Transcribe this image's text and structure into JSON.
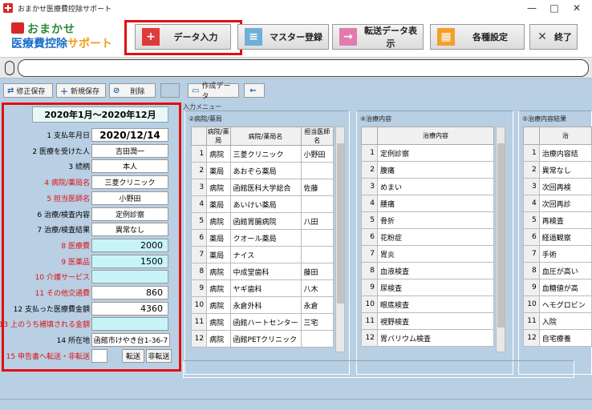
{
  "window": {
    "title": "おまかせ医療費控除サポート",
    "minimize": "—",
    "maximize": "□",
    "close": "✕"
  },
  "logo": {
    "line1": "おまかせ",
    "line2a": "医療費控除",
    "line2b": "サポート"
  },
  "toolbar": {
    "data_input": "データ入力",
    "master": "マスター登録",
    "transfer": "転送データ表示",
    "settings": "各種設定",
    "exit": "終了"
  },
  "subtoolbar": {
    "edit_save": "修正保存",
    "new_save": "新規保存",
    "delete": "削除",
    "create_data": "作成データ"
  },
  "left": {
    "date_range": "2020年1月～2020年12月",
    "rows": [
      {
        "label": "1 支払年月日",
        "value": "2020/12/14"
      },
      {
        "label": "2 医療を受けた人",
        "value": "吉田潤一"
      },
      {
        "label": "3 続柄",
        "value": "本人"
      },
      {
        "label": "4 病院/薬局名",
        "value": "三菱クリニック"
      },
      {
        "label": "5 担当医師名",
        "value": "小野田"
      },
      {
        "label": "6 治療/検査内容",
        "value": "定例診察"
      },
      {
        "label": "7 治療/検査結果",
        "value": "異常なし"
      },
      {
        "label": "8 医療費",
        "value": "2000"
      },
      {
        "label": "9 医薬品",
        "value": "1500"
      },
      {
        "label": "10 介護サービス",
        "value": ""
      },
      {
        "label": "11 その他交通費",
        "value": "860"
      },
      {
        "label": "12 支払った医療費金額",
        "value": "4360"
      },
      {
        "label": "13 上のうち補填される金額",
        "value": ""
      },
      {
        "label": "14 所在地",
        "value": "函館市けやき台1-36-7"
      },
      {
        "label": "15 申告書へ転送・非転送",
        "value": ""
      }
    ],
    "transfer_btn": "転送",
    "no_transfer_btn": "非転送"
  },
  "menu_title": "入力メニュー",
  "group1": {
    "title": "②病院/薬局",
    "headers": [
      "病院/薬局",
      "病院/薬局名",
      "担当医師名"
    ],
    "rows": [
      [
        "1",
        "病院",
        "三菱クリニック",
        "小野田"
      ],
      [
        "2",
        "薬局",
        "あおぞら薬局",
        ""
      ],
      [
        "3",
        "病院",
        "函館医科大学総合",
        "佐藤"
      ],
      [
        "4",
        "薬局",
        "あいけい薬局",
        ""
      ],
      [
        "5",
        "病院",
        "函館胃腸病院",
        "八田"
      ],
      [
        "6",
        "薬局",
        "クオール薬局",
        ""
      ],
      [
        "7",
        "薬局",
        "ナイス",
        ""
      ],
      [
        "8",
        "病院",
        "中成堂歯科",
        "藤田"
      ],
      [
        "9",
        "病院",
        "ヤギ歯科",
        "八木"
      ],
      [
        "10",
        "病院",
        "永倉外科",
        "永倉"
      ],
      [
        "11",
        "病院",
        "函館ハートセンター",
        "三宅"
      ],
      [
        "12",
        "病院",
        "函館PETクリニック",
        ""
      ]
    ]
  },
  "group2": {
    "title": "④治療内容",
    "headers": [
      "治療内容"
    ],
    "rows": [
      [
        "1",
        "定例診察"
      ],
      [
        "2",
        "腹痛"
      ],
      [
        "3",
        "めまい"
      ],
      [
        "4",
        "腰痛"
      ],
      [
        "5",
        "骨折"
      ],
      [
        "6",
        "花粉症"
      ],
      [
        "7",
        "胃炎"
      ],
      [
        "8",
        "血液検査"
      ],
      [
        "9",
        "尿検査"
      ],
      [
        "10",
        "眼底検査"
      ],
      [
        "11",
        "視野検査"
      ],
      [
        "12",
        "胃バリウム検査"
      ]
    ]
  },
  "group3": {
    "title": "⑤治療内容結果",
    "headers": [
      "治"
    ],
    "rows": [
      [
        "1",
        "治療内容結"
      ],
      [
        "2",
        "異常なし"
      ],
      [
        "3",
        "次回再検"
      ],
      [
        "4",
        "次回再診"
      ],
      [
        "5",
        "再検査"
      ],
      [
        "6",
        "経過観察"
      ],
      [
        "7",
        "手術"
      ],
      [
        "8",
        "血圧が高い"
      ],
      [
        "9",
        "血糖値が高"
      ],
      [
        "10",
        "ヘモグロビン"
      ],
      [
        "11",
        "入院"
      ],
      [
        "12",
        "自宅療養"
      ]
    ]
  }
}
